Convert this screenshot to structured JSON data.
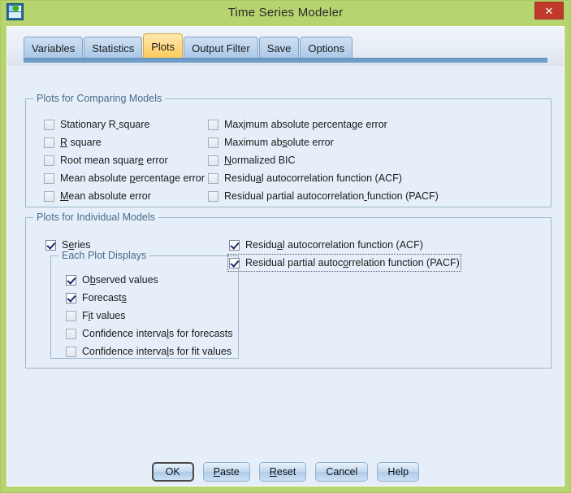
{
  "window": {
    "title": "Time Series Modeler",
    "app_icon": "spss-app-icon",
    "close_label": "✕"
  },
  "tabs": [
    {
      "label": "Variables",
      "selected": false
    },
    {
      "label": "Statistics",
      "selected": false
    },
    {
      "label": "Plots",
      "selected": true
    },
    {
      "label": "Output Filter",
      "selected": false
    },
    {
      "label": "Save",
      "selected": false
    },
    {
      "label": "Options",
      "selected": false
    }
  ],
  "comparing_models": {
    "title": "Plots for Comparing Models",
    "left_column": [
      {
        "label": "Stationary R square",
        "checked": false,
        "mnemonic_index": 12
      },
      {
        "label": "R square",
        "checked": false,
        "mnemonic_index": 0
      },
      {
        "label": "Root mean square error",
        "checked": false,
        "mnemonic_index": 15
      },
      {
        "label": "Mean absolute percentage error",
        "checked": false,
        "mnemonic_index": 14
      },
      {
        "label": "Mean absolute error",
        "checked": false,
        "mnemonic_index": 0
      }
    ],
    "right_column": [
      {
        "label": "Maximum absolute percentage error",
        "checked": false,
        "mnemonic_index": 3
      },
      {
        "label": "Maximum absolute error",
        "checked": false,
        "mnemonic_index": 10
      },
      {
        "label": "Normalized BIC",
        "checked": false,
        "mnemonic_index": 0
      },
      {
        "label": "Residual autocorrelation function (ACF)",
        "checked": false,
        "mnemonic_index": 6
      },
      {
        "label": "Residual partial autocorrelation function (PACF)",
        "checked": false,
        "mnemonic_index": 32
      }
    ]
  },
  "individual_models": {
    "title": "Plots for Individual Models",
    "series": {
      "label": "Series",
      "checked": true,
      "mnemonic_index": 1
    },
    "each_plot_displays": {
      "title": "Each Plot Displays",
      "items": [
        {
          "label": "Observed values",
          "checked": true,
          "mnemonic_index": 1
        },
        {
          "label": "Forecasts",
          "checked": true,
          "mnemonic_index": 8
        },
        {
          "label": "Fit values",
          "checked": false,
          "mnemonic_index": 1
        },
        {
          "label": "Confidence intervals for forecasts",
          "checked": false,
          "mnemonic_index": 18
        },
        {
          "label": "Confidence intervals for fit values",
          "checked": false,
          "mnemonic_index": 18
        }
      ]
    },
    "right_column": [
      {
        "label": "Residual autocorrelation function (ACF)",
        "checked": true,
        "mnemonic_index": 6,
        "focused": false
      },
      {
        "label": "Residual partial autocorrelation function (PACF)",
        "checked": true,
        "mnemonic_index": 22,
        "focused": true
      }
    ]
  },
  "buttons": [
    {
      "label": "OK",
      "default": true,
      "mnemonic_index": -1
    },
    {
      "label": "Paste",
      "default": false,
      "mnemonic_index": 0
    },
    {
      "label": "Reset",
      "default": false,
      "mnemonic_index": 0
    },
    {
      "label": "Cancel",
      "default": false,
      "mnemonic_index": -1
    },
    {
      "label": "Help",
      "default": false,
      "mnemonic_index": -1
    }
  ],
  "colors": {
    "window_frame": "#b6d470",
    "client_background": "#e6eff9",
    "tab_selected": "#ffc955",
    "tab_normal": "#a8c6e6",
    "tab_underline": "#6f9dc8",
    "close_button": "#c0392b",
    "group_border": "#9fb6cb",
    "group_title_text": "#4a6b88"
  }
}
